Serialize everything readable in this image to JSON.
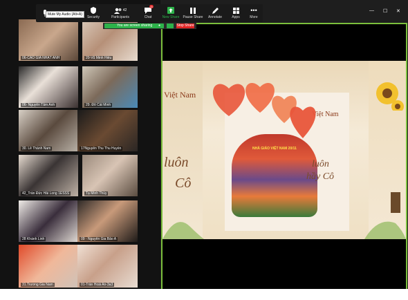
{
  "toolbar": {
    "tooltip": "Mute My Audio (Alt+A)",
    "buttons": [
      {
        "label": "Security"
      },
      {
        "label": "Participants",
        "count": "42"
      },
      {
        "label": "Chat",
        "badge": "11"
      },
      {
        "label": "New Share"
      },
      {
        "label": "Pause Share"
      },
      {
        "label": "Annotate"
      },
      {
        "label": "Apps"
      },
      {
        "label": "More"
      }
    ]
  },
  "sharing": {
    "status": "You are screen sharing",
    "stop_label": "Stop Share"
  },
  "gallery": {
    "tiles": [
      {
        "name": "06-CAO GIA NHẬT ANH"
      },
      {
        "name": "20-Vũ Minh Hiếu"
      },
      {
        "name": "06- Nguyễn Tâm Anh"
      },
      {
        "name": "29. Đỗ Cát Minh"
      },
      {
        "name": "30. Lê Thành Nam"
      },
      {
        "name": "17Nguyễn Thu Thu Huyền"
      },
      {
        "name": "42_Trần Đức Hải Long 1ESSS"
      },
      {
        "name": "Tạ Minh Thùy"
      },
      {
        "name": "28 Khánh Linh"
      },
      {
        "name": "09 - Nguyễn Gia Bảo A"
      },
      {
        "name": "31.Trương Gia Nam"
      },
      {
        "name": "01-Trần Hoài An-3a3"
      }
    ]
  },
  "slide": {
    "line1": "Việt Nam",
    "line2": "Việt Nam",
    "left_luon": "luôn",
    "left_co": "Cô",
    "center_luon": "luôn",
    "center_co": "hầy Cô",
    "banner": "NHÀ GIÁO VIỆT NAM 20/11"
  },
  "window": {
    "minimize": "—",
    "maximize": "☐",
    "close": "✕"
  }
}
